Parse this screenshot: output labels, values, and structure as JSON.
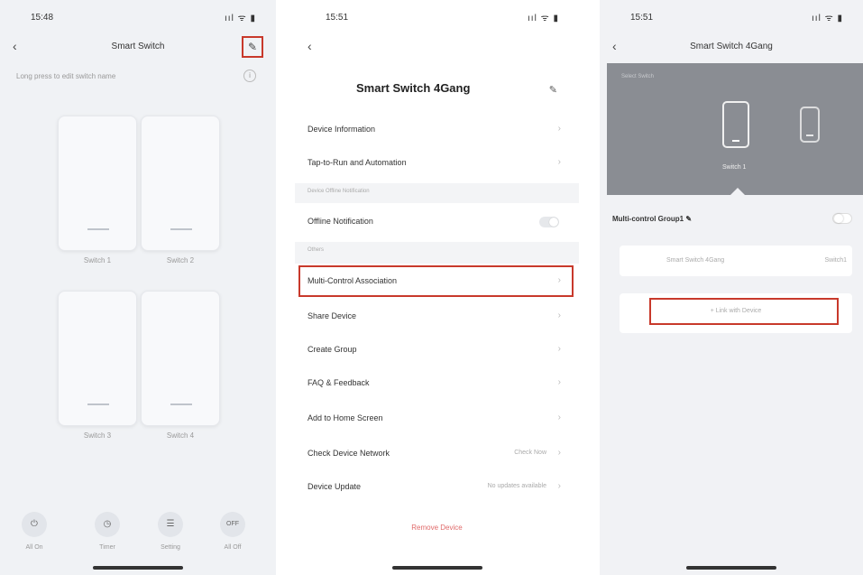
{
  "phone1": {
    "status": {
      "time": "15:48",
      "icons": "ııl ᯤ ▮"
    },
    "title": "Smart Switch",
    "back_icon": "back-chevron-icon",
    "edit_icon": "pencil-edit-icon",
    "hint": "Long press to edit switch name",
    "info_icon": "info-icon",
    "switches": [
      "Switch 1",
      "Switch 2",
      "Switch 3",
      "Switch 4"
    ],
    "bottom_nav": [
      {
        "icon": "power-icon",
        "glyph": "⏻",
        "label": "All On"
      },
      {
        "icon": "timer-icon",
        "glyph": "◷",
        "label": "Timer"
      },
      {
        "icon": "settings-icon",
        "glyph": "☰",
        "label": "Setting"
      },
      {
        "icon": "power-off-icon",
        "glyph": "OFF",
        "label": "All Off"
      }
    ]
  },
  "phone2": {
    "status": {
      "time": "15:51",
      "icons": "ııl ᯤ ▮"
    },
    "back_icon": "back-chevron-icon",
    "device_name": "Smart Switch 4Gang",
    "edit_icon": "pencil-edit-icon",
    "rows": [
      {
        "label": "Device Information",
        "value": ""
      },
      {
        "label": "Tap-to-Run and Automation",
        "value": ""
      }
    ],
    "section1": "Device Offline Notification",
    "offline_label": "Offline Notification",
    "section2": "Others",
    "rows2": [
      {
        "label": "Multi-Control Association",
        "value": ""
      },
      {
        "label": "Share Device",
        "value": ""
      },
      {
        "label": "Create Group",
        "value": ""
      },
      {
        "label": "FAQ & Feedback",
        "value": ""
      },
      {
        "label": "Add to Home Screen",
        "value": ""
      },
      {
        "label": "Check Device Network",
        "value": "Check Now"
      },
      {
        "label": "Device Update",
        "value": "No updates available"
      }
    ],
    "remove": "Remove Device"
  },
  "phone3": {
    "status": {
      "time": "15:51",
      "icons": "ııl ᯤ ▮"
    },
    "back_icon": "back-chevron-icon",
    "title": "Smart Switch 4Gang",
    "banner_small": "Select Switch",
    "switch_name": "Switch 1",
    "mcg_label": "Multi-control Group1 ✎",
    "card_left": "Smart Switch 4Gang",
    "card_right": "Switch1",
    "link_label": "+ Link with Device"
  },
  "accent": "#c8392b"
}
